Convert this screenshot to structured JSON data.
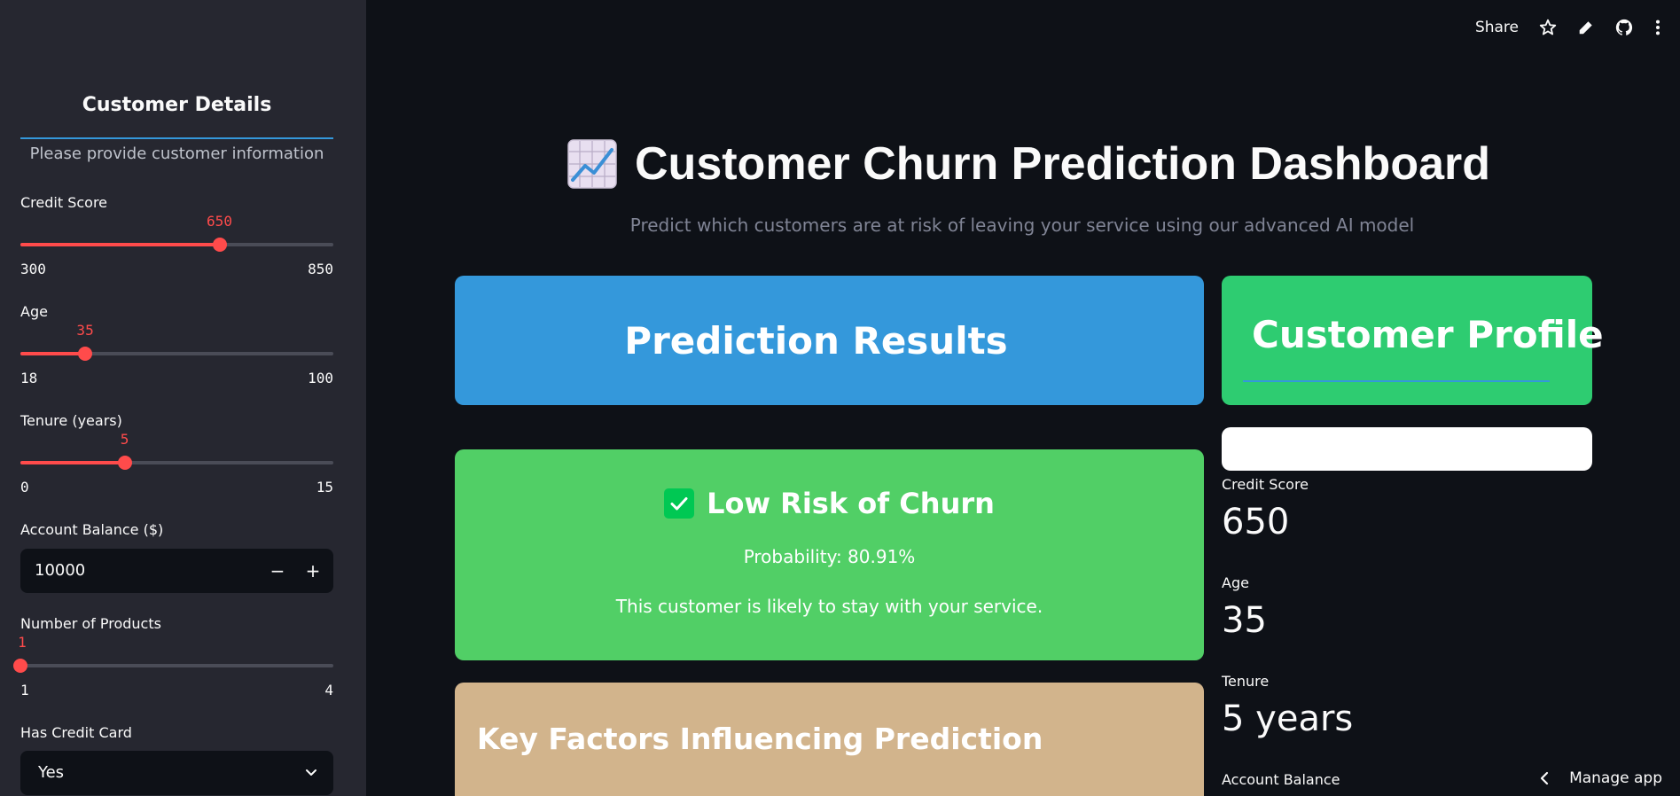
{
  "sidebar": {
    "title": "Customer Details",
    "subtitle": "Please provide customer information",
    "credit_score": {
      "label": "Credit Score",
      "value": "650",
      "min": "300",
      "max": "850",
      "fraction": 0.636
    },
    "age": {
      "label": "Age",
      "value": "35",
      "min": "18",
      "max": "100",
      "fraction": 0.207
    },
    "tenure": {
      "label": "Tenure (years)",
      "value": "5",
      "min": "0",
      "max": "15",
      "fraction": 0.333
    },
    "balance": {
      "label": "Account Balance ($)",
      "value": "10000",
      "minus": "−",
      "plus": "+"
    },
    "products": {
      "label": "Number of Products",
      "value": "1",
      "min": "1",
      "max": "4",
      "fraction": 0.0
    },
    "credit_card": {
      "label": "Has Credit Card",
      "value": "Yes"
    }
  },
  "toolbar": {
    "share_label": "Share"
  },
  "main": {
    "title": "Customer Churn Prediction Dashboard",
    "subtitle": "Predict which customers are at risk of leaving your service using our advanced AI model",
    "prediction_header": "Prediction Results",
    "profile_header": "Customer Profile",
    "risk": {
      "heading": "Low Risk of Churn",
      "probability": "Probability: 80.91%",
      "message": "This customer is likely to stay with your service."
    },
    "factors_heading": "Key Factors Influencing Prediction",
    "profile": {
      "credit_label": "Credit Score",
      "credit_value": "650",
      "age_label": "Age",
      "age_value": "35",
      "tenure_label": "Tenure",
      "tenure_value": "5 years",
      "balance_label": "Account Balance"
    }
  },
  "footer": {
    "manage_label": "Manage app"
  },
  "colors": {
    "accent": "#ff4b4b",
    "prediction_header": "#3498db",
    "profile_header": "#2ecc71",
    "risk_card": "#51cf66",
    "factors_card": "#d2b48c"
  }
}
